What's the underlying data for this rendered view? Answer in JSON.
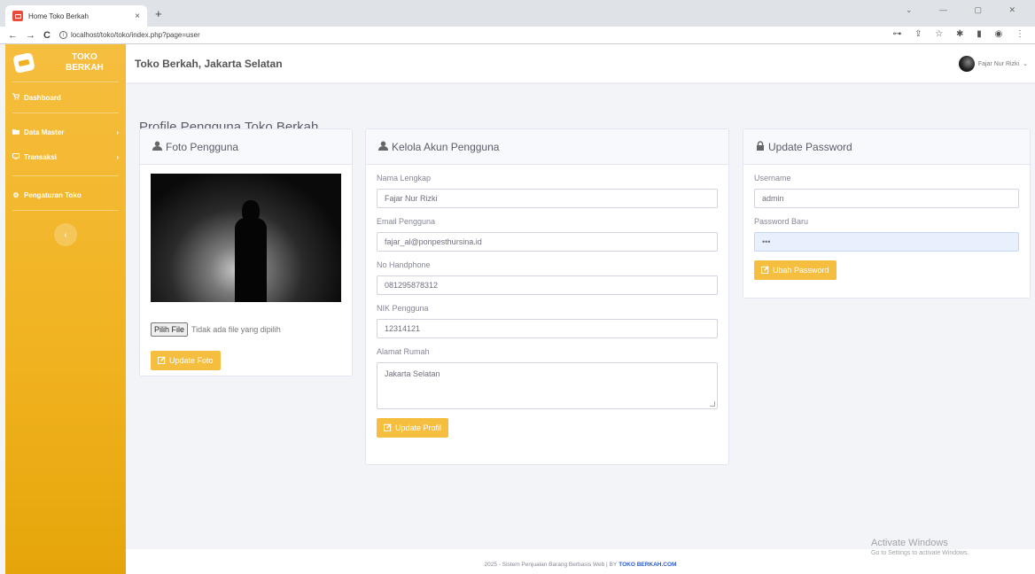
{
  "browser": {
    "tab_title": "Home Toko Berkah",
    "tab_close": "×",
    "new_tab": "+",
    "window_controls": "⌄ — ▢ ✕",
    "nav": {
      "back": "←",
      "forward": "→",
      "reload": "C",
      "info": "i"
    },
    "url": "localhost/toko/toko/index.php?page=user",
    "toolbar_icons": "⊶ ⇪ ☆ ✱ ▮ ◉ ⋮"
  },
  "sidebar": {
    "brand": "TOKO\nBERKAH",
    "items": [
      {
        "label": "Dashboard",
        "icon": "cart-icon",
        "glyph": "🛒",
        "has_chevron": false
      },
      {
        "label": "Data Master",
        "icon": "folder-icon",
        "glyph": "▆",
        "chevron": "›"
      },
      {
        "label": "Transaksi",
        "icon": "desktop-icon",
        "glyph": "▭",
        "chevron": "›"
      },
      {
        "label": "Pengaturan Toko",
        "icon": "cogs-icon",
        "glyph": "⚙"
      }
    ],
    "toggle": "‹"
  },
  "header": {
    "store_name": "Toko Berkah, Jakarta Selatan",
    "user_name": "Fajar Nur Rizki",
    "user_caret": "⌄"
  },
  "page_title": "Profile Pengguna Toko Berkah",
  "photo_card": {
    "title": "Foto Pengguna",
    "file_button": "Pilih File",
    "file_status": "Tidak ada file yang dipilih",
    "update_button": "Update Foto"
  },
  "account_card": {
    "title": "Kelola Akun Pengguna",
    "fields": [
      {
        "label": "Nama Lengkap",
        "value": "Fajar Nur Rizki"
      },
      {
        "label": "Email Pengguna",
        "value": "fajar_al@ponpesthursina.id"
      },
      {
        "label": "No Handphone",
        "value": "081295878312"
      },
      {
        "label": "NIK Pengguna",
        "value": "12314121"
      }
    ],
    "address_label": "Alamat Rumah",
    "address_value": "Jakarta Selatan",
    "update_button": "Update Profil"
  },
  "password_card": {
    "title": "Update Password",
    "username_label": "Username",
    "username_value": "admin",
    "password_label": "Password Baru",
    "password_value": "•••",
    "button": "Ubah Password"
  },
  "footer": {
    "text": "2025 - Sistem Penjualan Barang Berbasis Web | BY",
    "brand": "TOKO BERKAH.COM"
  },
  "watermark": {
    "title": "Activate Windows",
    "subtitle": "Go to Settings to activate Windows."
  },
  "colors": {
    "accent": "#f6be3f",
    "sidebar_dark": "#e5a50a",
    "link": "#2a5bd7"
  }
}
